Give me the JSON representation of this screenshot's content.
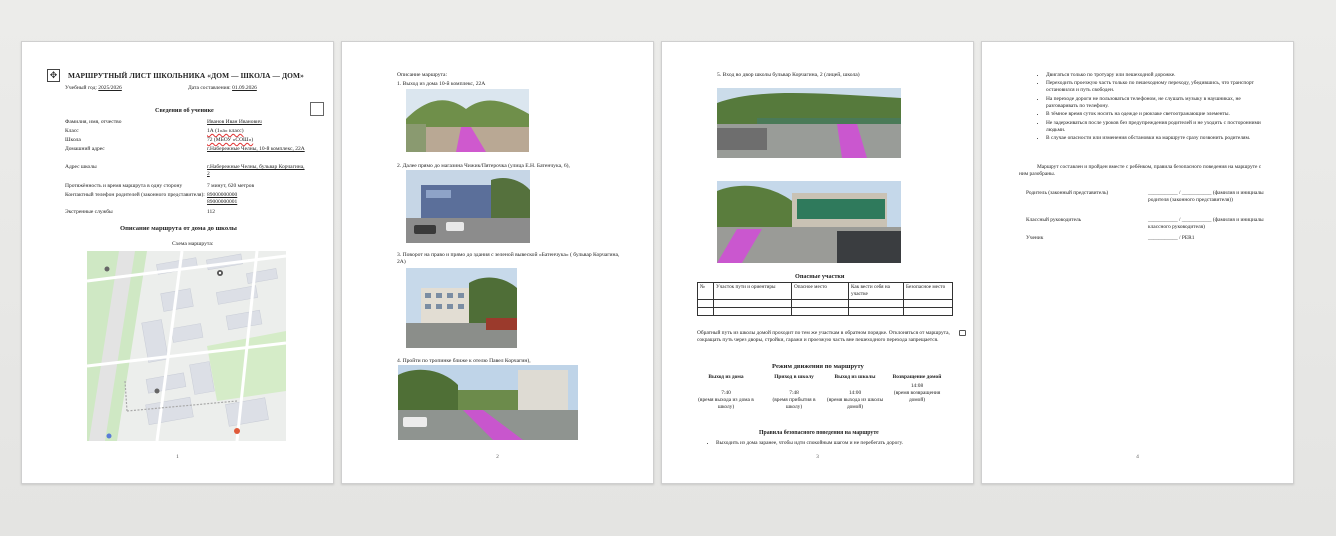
{
  "page1": {
    "title": "МАРШРУТНЫЙ ЛИСТ ШКОЛЬНИКА «ДОМ — ШКОЛА — ДОМ»",
    "year_label": "Учебный год:",
    "year_value": "2025/2026",
    "date_label": "Дата составления:",
    "date_value": "01.09.2026",
    "student_section": "Сведения об ученике",
    "rows": [
      {
        "label": "Фамилия, имя, отчество",
        "value": "Иванов Иван Иванович"
      },
      {
        "label": "Класс",
        "value": "1А (1«а» класс)"
      },
      {
        "label": "Школа",
        "value": "72 (МБОУ «СОШ»)"
      },
      {
        "label": "Домашний адрес",
        "value": "г.Набережные Челны, 10-й комплекс, 22А"
      },
      {
        "label": "Адрес школы",
        "value": "г.Набережные Челны, бульвар Корчагина, 2"
      },
      {
        "label": "Протяжённость и время маршрута в одну сторону",
        "value": "7 минут, 620 метров"
      },
      {
        "label": "Контактный телефон родителей (законного представителя):",
        "value": "89000000000 89000000001"
      },
      {
        "label": "Экстренные службы",
        "value": "112"
      }
    ],
    "route_section": "Описание маршрута от дома до школы",
    "scheme_label": "Схема маршрута:",
    "page_number": "1"
  },
  "page2": {
    "intro": "Описание маршрута:",
    "items": [
      "1.   Выход из дома 10-й комплекс, 22А",
      "2.   Далее прямо до магазина Чижик/Пятерочка (улица Е.Н. Батенчука, 6),",
      "3.   Поворот на право и прямо до здания с зеленой вывеской «Батенчука» ( бульвар Корчагина, 2А)",
      "4.   Пройти по тропинке ближе к отелю Павел Корчагин),"
    ],
    "page_number": "2"
  },
  "page3": {
    "item5": "5.   Вход во двор школы бульвар Корчагина, 2 (лицей, школа)",
    "danger_title": "Опасные участки",
    "table_headers": [
      "№",
      "Участок пути и ориентиры",
      "Опасное место",
      "Как вести себя на участке",
      "Безопасное место"
    ],
    "return_note": "Обратный путь из школы домой проходит по тем же участкам в обратном порядке. Отклоняться от маршрута, сокращать путь через дворы, стройки, гаражи и проезжую часть вне пешеходного перехода запрещается.",
    "schedule_title": "Режим движения по маршруту",
    "schedule": [
      {
        "head": "Выход из дома",
        "time": "7:40",
        "note": "(время выхода из дома в школу)"
      },
      {
        "head": "Приход в школу",
        "time": "7:48",
        "note": "(время прибытия в школу)"
      },
      {
        "head": "Выход из школы",
        "time": "14:00",
        "note": "(время выхода из школы домой)"
      },
      {
        "head": "Возвращение домой",
        "time": "14:08",
        "note": "(время возвращения домой)"
      }
    ],
    "rules_title": "Правила безопасного поведения на маршруте",
    "rule1": "Выходить из дома заранее, чтобы идти спокойным шагом и не перебегать дорогу.",
    "page_number": "3"
  },
  "page4": {
    "bullets": [
      "Двигаться только по тротуару или пешеходной дорожке.",
      "Переходить проезжую часть только по пешеходному переходу, убедившись, что транспорт остановился и путь свободен.",
      "На переходе дороги не пользоваться телефоном, не слушать музыку в наушниках, не разговаривать по телефону.",
      "В тёмное время суток носить на одежде и рюкзаке светоотражающие элементы.",
      "Не задерживаться после уроков без предупреждения родителей и не уходить с посторонними людьми.",
      "В случае опасности или изменения обстановки на маршруте сразу позвонить родителям."
    ],
    "closing": "Маршрут составлен и пройден вместе с ребёнком, правила безопасного поведения на маршруте с ним разобраны.",
    "signs": [
      {
        "label": "Родитель (законный представитель)",
        "line": "___________ / ___________ (фамилия и инициалы родителя (законного представителя))"
      },
      {
        "label": "Классный руководитель",
        "line": "___________ / ___________ (фамилия и инициалы классного руководителя)"
      },
      {
        "label": "Ученик",
        "line": "___________ / PER1"
      }
    ],
    "page_number": "4"
  }
}
